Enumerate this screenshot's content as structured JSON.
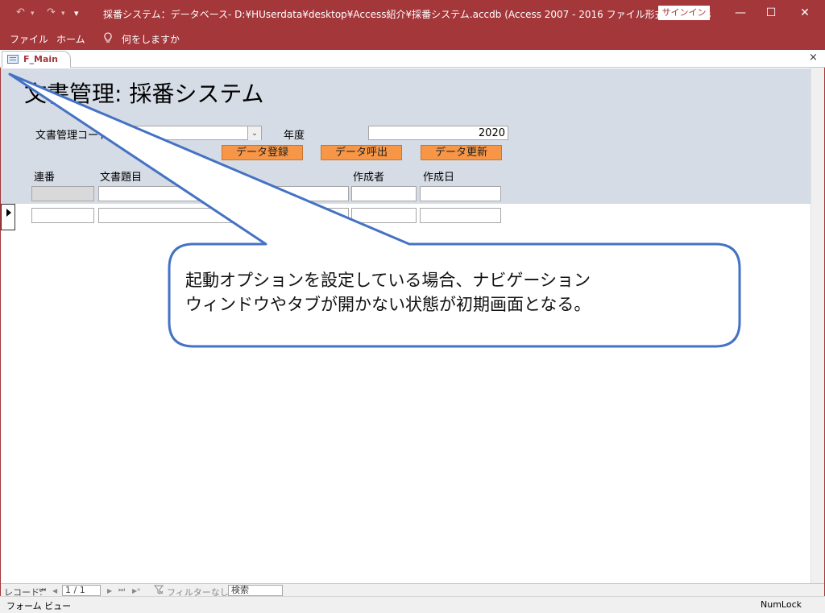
{
  "window": {
    "title": "採番システム：データベース- D:¥HUserdata¥desktop¥Access紹介¥採番システム.accdb (Access 2007 - 2016 ファイル形式)  -  Access",
    "signin_label": "サインイン",
    "undo_icon": "undo-icon",
    "redo_icon": "redo-icon",
    "minimize": "—",
    "restore": "☐",
    "close": "✕"
  },
  "ribbon": {
    "tabs": [
      "ファイル",
      "ホーム"
    ],
    "tell_me": "何をしますか"
  },
  "doc_tab": {
    "label": "F_Main",
    "close": "×"
  },
  "form": {
    "title": "文書管理:  採番システム",
    "code_label": "文書管理コード",
    "year_label": "年度",
    "year_value": "2020",
    "buttons": {
      "register": "データ登録",
      "fetch": "データ呼出",
      "update": "データ更新"
    },
    "columns": {
      "serial": "連番",
      "doc_title": "文書題目",
      "author": "作成者",
      "date": "作成日"
    }
  },
  "navbar": {
    "record_label": "レコード:",
    "first": "⏮",
    "prev": "◀",
    "record_value": "1 / 1",
    "next": "▶",
    "last": "⏭",
    "new": "▶*",
    "filter_label": "フィルターなし",
    "search_placeholder": "検索"
  },
  "statusbar": {
    "view": "フォーム ビュー",
    "numlock": "NumLock"
  },
  "callout": {
    "line1": "起動オプションを設定している場合、ナビゲーション",
    "line2": "ウィンドウやタブが開かない状態が初期画面となる。"
  },
  "colors": {
    "accent": "#a4373a",
    "header_bg": "#d6dce6",
    "button_orange": "#f79646",
    "callout_border": "#4472c4"
  }
}
